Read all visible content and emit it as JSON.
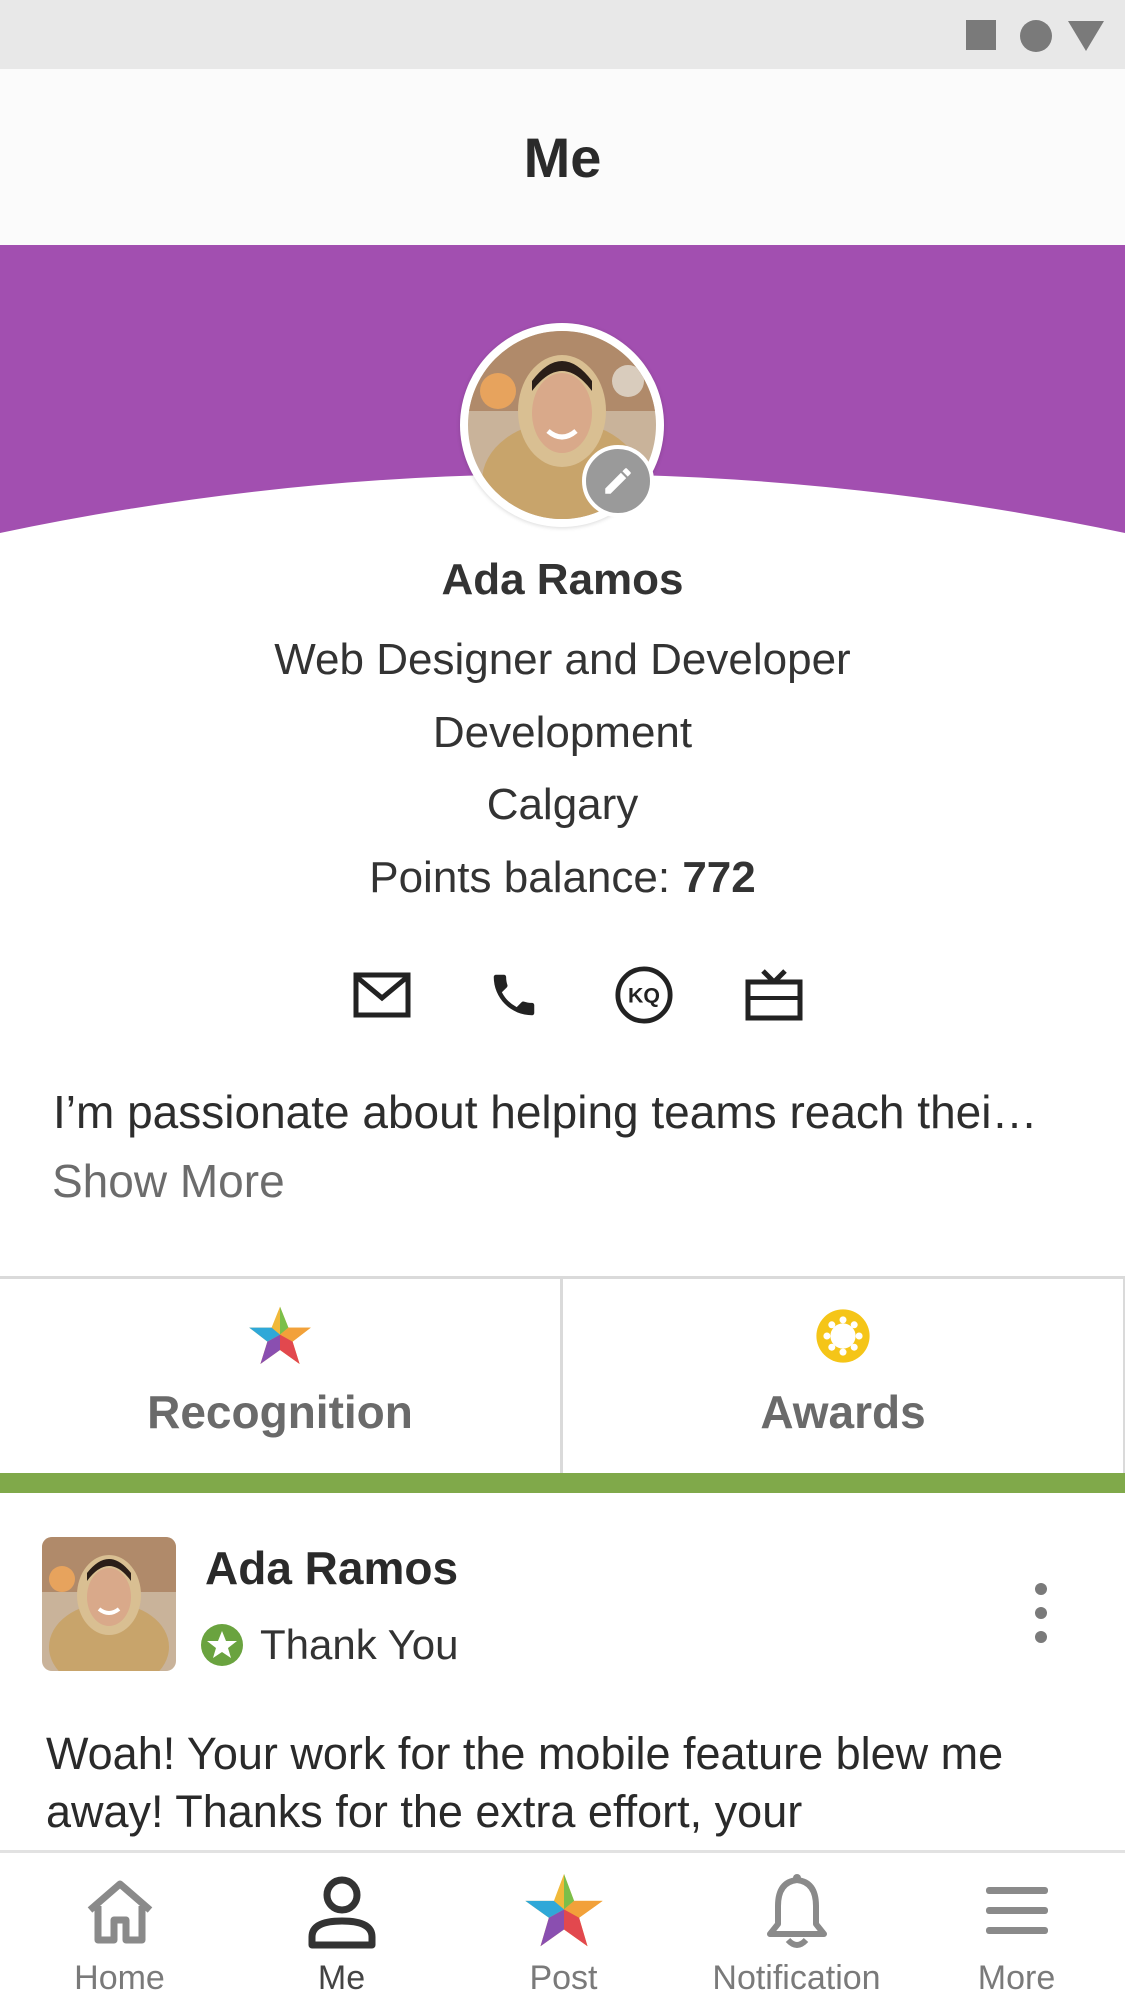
{
  "header": {
    "title": "Me"
  },
  "profile": {
    "name": "Ada Ramos",
    "job_title": "Web Designer and Developer",
    "department": "Development",
    "location": "Calgary",
    "points_label": "Points balance: ",
    "points_value": "772",
    "bio": "I’m passionate about helping teams reach thei…",
    "show_more": "Show More",
    "contact_icons": [
      "mail-icon",
      "phone-icon",
      "kq-icon",
      "gift-card-icon"
    ]
  },
  "tabs": [
    {
      "label": "Recognition",
      "icon": "star-icon",
      "active": true
    },
    {
      "label": "Awards",
      "icon": "award-badge-icon",
      "active": false
    }
  ],
  "colors": {
    "banner": "#a24fb0",
    "tab_underline": "#80a94a",
    "award_gold": "#f5c518",
    "tag_green": "#6aa33f"
  },
  "post": {
    "author": "Ada Ramos",
    "tag": "Thank You",
    "body": "Woah! Your work for the mobile feature blew me away! Thanks for the extra effort, your"
  },
  "bottom_nav": [
    {
      "label": "Home",
      "icon": "home-icon"
    },
    {
      "label": "Me",
      "icon": "person-icon",
      "active": true
    },
    {
      "label": "Post",
      "icon": "star-icon"
    },
    {
      "label": "Notification",
      "icon": "bell-icon"
    },
    {
      "label": "More",
      "icon": "menu-icon"
    }
  ]
}
